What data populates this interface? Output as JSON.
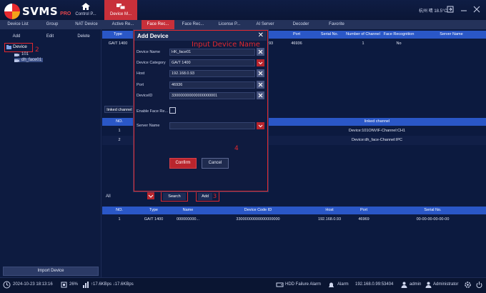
{
  "app": {
    "logo_text": "SVMS",
    "logo_pro": "PRO",
    "modules": [
      {
        "label": "Control P...",
        "icon": "home-icon"
      },
      {
        "label": "Device M...",
        "icon": "device-manage-icon"
      }
    ],
    "weather": "杭州 晴 18.5°C"
  },
  "subtabs": [
    "Device List",
    "Group",
    "NAT Device",
    "Active Re...",
    "Face Rec...",
    "Face Rec...",
    "License P...",
    "AI Server",
    "Decoder",
    "Favorite"
  ],
  "left": {
    "buttons": {
      "add": "Add",
      "edit": "Edit",
      "delete": "Delete"
    },
    "tree_root": "Device",
    "tree_children": [
      "101",
      "dh_face01"
    ],
    "annotation": "2",
    "import": "Import Device"
  },
  "device_table": {
    "headers": [
      "Type",
      "Port",
      "Serial No.",
      "Number of Channel",
      "Face Recognition",
      "Server Name"
    ],
    "row": {
      "type": "GA/T 1400",
      "port_prefix": "93",
      "port": "46936",
      "channels": "1",
      "face": "No"
    }
  },
  "linked": {
    "label": "linked channel",
    "headers": [
      "NO.",
      "linked channel"
    ],
    "rows": [
      {
        "no": "1",
        "channel": "Device:101ONVIF-Channel:CH1"
      },
      {
        "no": "2",
        "channel": "Device:dh_face-Channel:IPC"
      }
    ]
  },
  "search_bar": {
    "filter": "All",
    "search": "Search",
    "add": "Add",
    "annotation": "3"
  },
  "result_table": {
    "headers": [
      "NO.",
      "Type",
      "Name",
      "Device Code ID",
      "Host",
      "Port",
      "Serial No."
    ],
    "rows": [
      {
        "no": "1",
        "type": "GA/T 1400",
        "name": "000000000...",
        "code": "33000000000000000000",
        "host": "192.168.0.93",
        "port": "46969",
        "serial": "00-00-00-00-00-00"
      }
    ]
  },
  "modal": {
    "title": "Add Device",
    "annotation_title": "Input Device Name",
    "annotation_4": "4",
    "fields": {
      "device_name": {
        "label": "Device Name",
        "value": "HK_face01"
      },
      "device_category": {
        "label": "Device Category",
        "value": "GA/T 1400"
      },
      "host": {
        "label": "Host",
        "value": "192.168.0.93"
      },
      "port": {
        "label": "Port",
        "value": "46936"
      },
      "device_id": {
        "label": "DeviceID",
        "value": "330000000000000000001"
      },
      "enable_face": {
        "label": "Enable Face Re..."
      },
      "server_name": {
        "label": "Server Name",
        "value": ""
      }
    },
    "confirm": "Confirm",
    "cancel": "Cancel"
  },
  "status": {
    "datetime": "2024-10-23 18:13:16",
    "cpu": "26%",
    "net": "↑17.6KBps ↓17.6KBps",
    "hdd": "HDD Failure Alarm",
    "alarm": "Alarm",
    "ip": "192.168.0.99:53404",
    "user": "admin",
    "role": "Administrator"
  },
  "colors": {
    "accent": "#c8303a",
    "header_blue": "#2a57c7",
    "bg": "#0c1a3f"
  }
}
